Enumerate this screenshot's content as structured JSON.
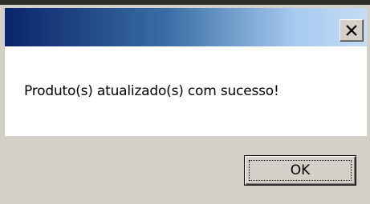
{
  "dialog": {
    "message": "Produto(s) atualizado(s) com sucesso!",
    "ok_label": "OK",
    "close_icon": "close-icon",
    "titlebar_gradient": [
      "#0a246a",
      "#a6caf0"
    ],
    "button_face_color": "#d4d0c8"
  }
}
